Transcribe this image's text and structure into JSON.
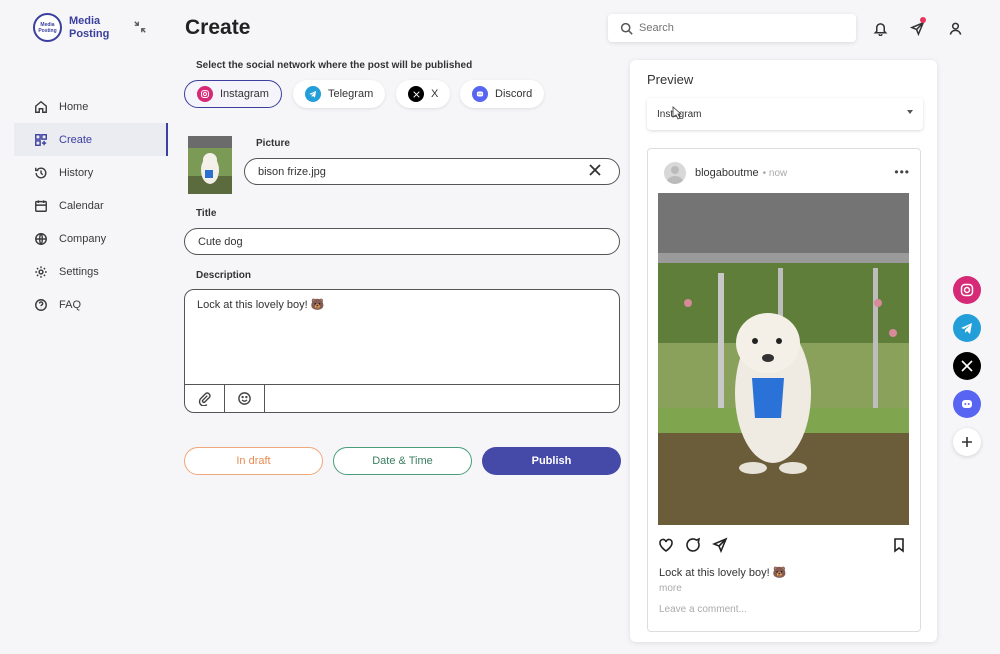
{
  "brand": {
    "line1": "Media",
    "line2": "Posting",
    "logo_text": "Media Posting"
  },
  "nav": {
    "items": [
      {
        "label": "Home",
        "icon": "home-icon"
      },
      {
        "label": "Create",
        "icon": "grid-plus-icon",
        "active": true
      },
      {
        "label": "History",
        "icon": "history-icon"
      },
      {
        "label": "Calendar",
        "icon": "calendar-icon"
      },
      {
        "label": "Company",
        "icon": "globe-icon"
      },
      {
        "label": "Settings",
        "icon": "gear-icon"
      },
      {
        "label": "FAQ",
        "icon": "help-icon"
      }
    ]
  },
  "header": {
    "title": "Create",
    "search_placeholder": "Search"
  },
  "form": {
    "network_label": "Select the social network where the post will be published",
    "networks": [
      {
        "label": "Instagram",
        "color": "#d62976",
        "active": true
      },
      {
        "label": "Telegram",
        "color": "#229ed9"
      },
      {
        "label": "X",
        "color": "#000000"
      },
      {
        "label": "Discord",
        "color": "#5865f2"
      }
    ],
    "picture_label": "Picture",
    "picture_value": "bison frize.jpg",
    "title_label": "Title",
    "title_value": "Cute dog",
    "description_label": "Description",
    "description_value": "Lock at this lovely boy! 🐻",
    "buttons": {
      "draft": "In draft",
      "date": "Date & Time",
      "publish": "Publish"
    }
  },
  "preview": {
    "title": "Preview",
    "network_selected": "Instagram",
    "post": {
      "username": "blogaboutme",
      "time": "now",
      "caption": "Lock at this lovely boy! 🐻",
      "more": "more",
      "comment_placeholder": "Leave a comment..."
    }
  },
  "colors": {
    "accent": "#3b3f9e",
    "publish": "#4549a8",
    "draft": "#e88b52",
    "date": "#3b7d62"
  }
}
